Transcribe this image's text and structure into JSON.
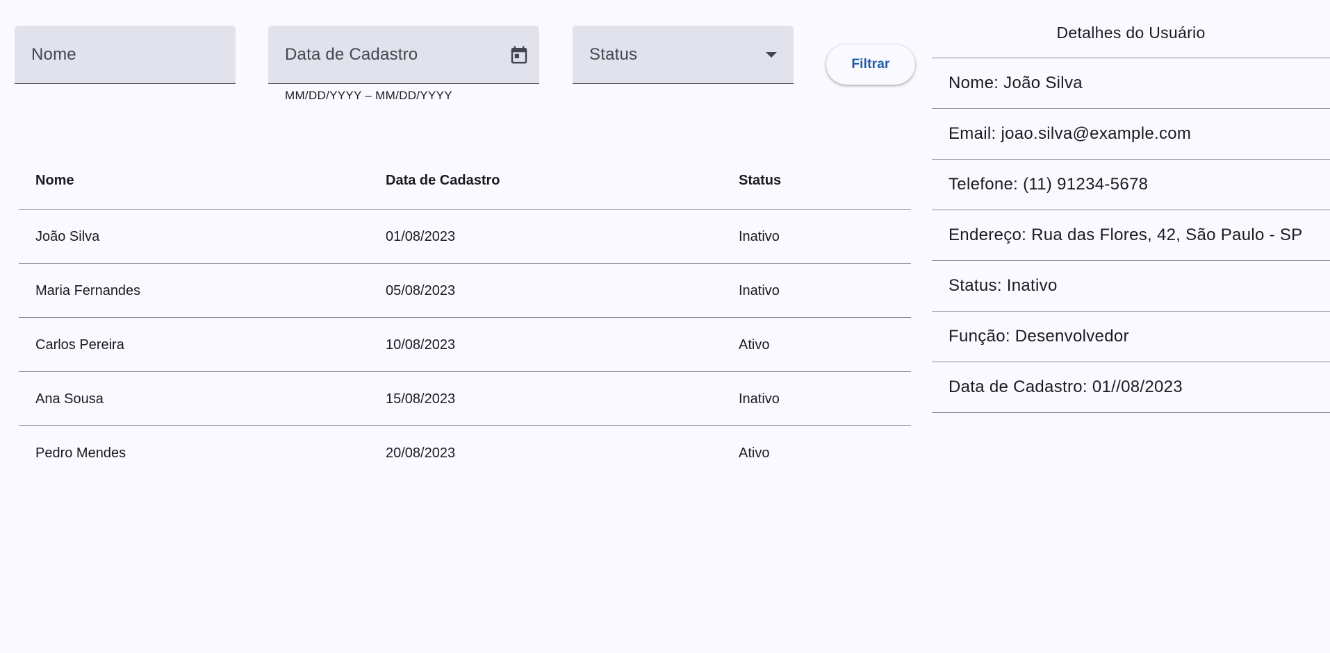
{
  "filters": {
    "nome_label": "Nome",
    "data_label": "Data de Cadastro",
    "data_hint": "MM/DD/YYYY – MM/DD/YYYY",
    "status_label": "Status",
    "filter_button": "Filtrar",
    "icons": {
      "date": "calendar-icon",
      "status": "arrow-drop-down-icon"
    }
  },
  "table": {
    "headers": [
      "Nome",
      "Data de Cadastro",
      "Status"
    ],
    "rows": [
      [
        "João Silva",
        "01/08/2023",
        "Inativo"
      ],
      [
        "Maria Fernandes",
        "05/08/2023",
        "Inativo"
      ],
      [
        "Carlos Pereira",
        "10/08/2023",
        "Ativo"
      ],
      [
        "Ana Sousa",
        "15/08/2023",
        "Inativo"
      ],
      [
        "Pedro Mendes",
        "20/08/2023",
        "Ativo"
      ]
    ]
  },
  "details": {
    "title": "Detalhes do Usuário",
    "items": [
      "Nome: João Silva",
      "Email: joao.silva@example.com",
      "Telefone: (11) 91234-5678",
      "Endereço: Rua das Flores, 42, São Paulo - SP",
      "Status: Inativo",
      "Função: Desenvolvedor",
      "Data de Cadastro: 01//08/2023"
    ]
  },
  "colors": {
    "background": "#f9f9ff",
    "field_fill": "#e1e2ec",
    "primary": "#1e5aa6",
    "divider": "#8a8b93"
  }
}
